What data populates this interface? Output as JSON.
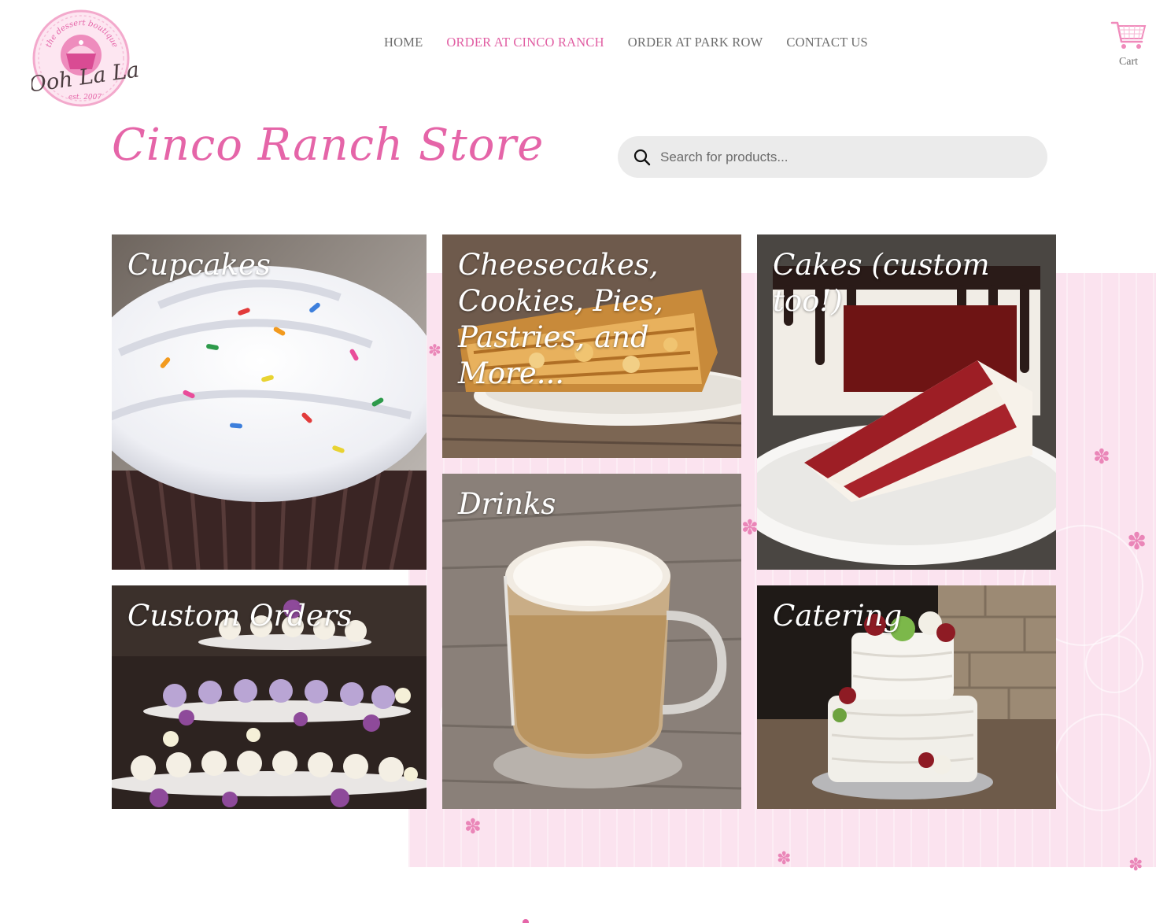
{
  "logo": {
    "top_text": "the dessert boutique",
    "name": "Ooh La La",
    "est": "est. 2007"
  },
  "nav": {
    "items": [
      {
        "label": "HOME"
      },
      {
        "label": "ORDER AT CINCO RANCH"
      },
      {
        "label": "ORDER AT PARK ROW"
      },
      {
        "label": "CONTACT US"
      }
    ],
    "active_index": 1
  },
  "cart": {
    "label": "Cart",
    "icon": "cart-icon"
  },
  "page": {
    "title": "Cinco Ranch Store"
  },
  "search": {
    "placeholder": "Search for products...",
    "icon": "search-icon"
  },
  "categories": [
    {
      "label": "Cupcakes",
      "image": "cupcake-photo"
    },
    {
      "label": "Cheesecakes, Cookies, Pies, Pastries, and More...",
      "image": "pie-photo"
    },
    {
      "label": "Cakes (custom too!)",
      "image": "red-velvet-cake-photo"
    },
    {
      "label": "Drinks",
      "image": "latte-photo"
    },
    {
      "label": "Custom Orders",
      "image": "cupcake-tower-photo"
    },
    {
      "label": "Catering",
      "image": "wedding-cake-photo"
    }
  ],
  "colors": {
    "accent": "#e565a8",
    "nav_active": "#e15fa3",
    "nav_text": "#6e6e6e",
    "pink_background": "#fbe3ef",
    "search_bg": "#ebebeb"
  }
}
